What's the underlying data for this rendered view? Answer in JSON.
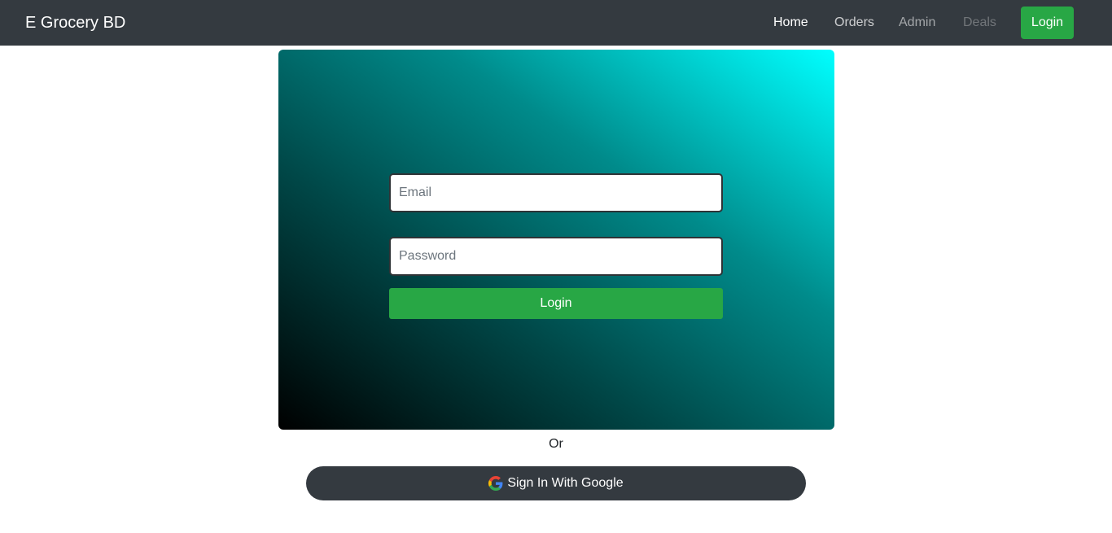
{
  "navbar": {
    "brand": "E Grocery BD",
    "links": [
      {
        "label": "Home",
        "state": "active"
      },
      {
        "label": "Orders",
        "state": "normal"
      },
      {
        "label": "Admin",
        "state": "muted"
      },
      {
        "label": "Deals",
        "state": "disabled"
      }
    ],
    "login_button": "Login"
  },
  "login_form": {
    "email_placeholder": "Email",
    "password_placeholder": "Password",
    "submit_label": "Login"
  },
  "separator_text": "Or",
  "google_button": {
    "label": "Sign In With Google",
    "icon": "google-icon"
  },
  "colors": {
    "navbar_bg": "#343a40",
    "success_green": "#28a745",
    "gradient_start": "#000000",
    "gradient_end": "#00ffff"
  }
}
